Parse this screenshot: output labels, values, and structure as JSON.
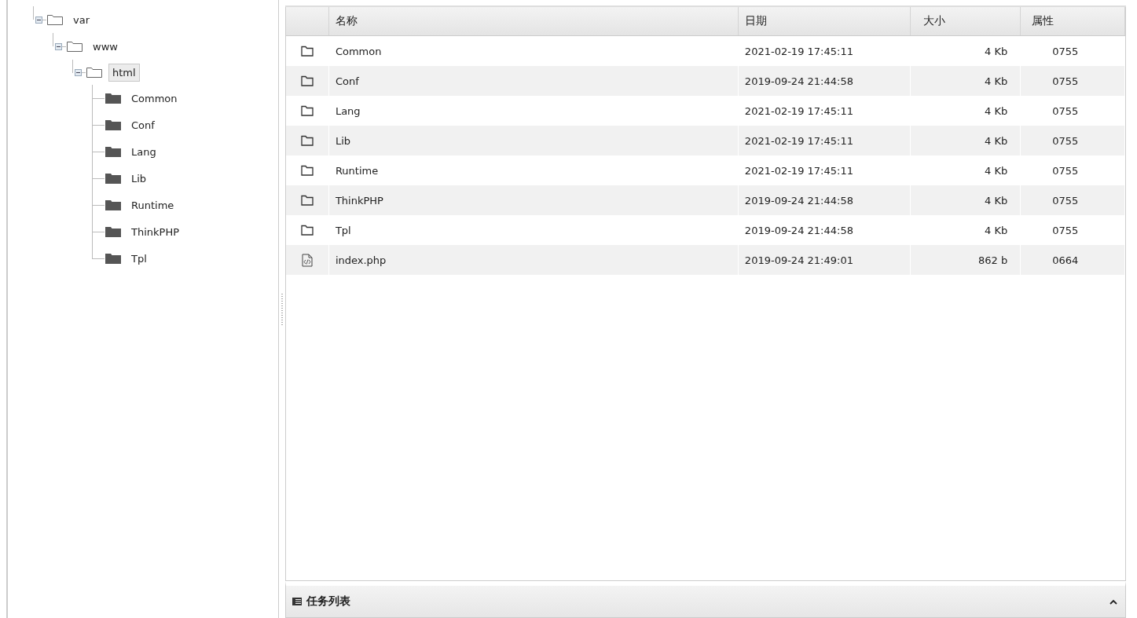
{
  "tree": [
    {
      "label": "var",
      "expanded": true,
      "selected": false,
      "children": [
        {
          "label": "www",
          "expanded": true,
          "selected": false,
          "children": [
            {
              "label": "html",
              "expanded": true,
              "selected": true,
              "children": [
                {
                  "label": "Common",
                  "selected": false
                },
                {
                  "label": "Conf",
                  "selected": false
                },
                {
                  "label": "Lang",
                  "selected": false
                },
                {
                  "label": "Lib",
                  "selected": false
                },
                {
                  "label": "Runtime",
                  "selected": false
                },
                {
                  "label": "ThinkPHP",
                  "selected": false
                },
                {
                  "label": "Tpl",
                  "selected": false
                }
              ]
            }
          ]
        }
      ]
    }
  ],
  "table": {
    "columns": [
      "名称",
      "日期",
      "大小",
      "属性"
    ],
    "rows": [
      {
        "kind": "folder",
        "name": "Common",
        "date": "2021-02-19 17:45:11",
        "size": "4 Kb",
        "mode": "0755"
      },
      {
        "kind": "folder",
        "name": "Conf",
        "date": "2019-09-24 21:44:58",
        "size": "4 Kb",
        "mode": "0755"
      },
      {
        "kind": "folder",
        "name": "Lang",
        "date": "2021-02-19 17:45:11",
        "size": "4 Kb",
        "mode": "0755"
      },
      {
        "kind": "folder",
        "name": "Lib",
        "date": "2021-02-19 17:45:11",
        "size": "4 Kb",
        "mode": "0755"
      },
      {
        "kind": "folder",
        "name": "Runtime",
        "date": "2021-02-19 17:45:11",
        "size": "4 Kb",
        "mode": "0755"
      },
      {
        "kind": "folder",
        "name": "ThinkPHP",
        "date": "2019-09-24 21:44:58",
        "size": "4 Kb",
        "mode": "0755"
      },
      {
        "kind": "folder",
        "name": "Tpl",
        "date": "2019-09-24 21:44:58",
        "size": "4 Kb",
        "mode": "0755"
      },
      {
        "kind": "code",
        "name": "index.php",
        "date": "2019-09-24 21:49:01",
        "size": "862 b",
        "mode": "0664"
      }
    ]
  },
  "task_panel": {
    "title": "任务列表",
    "expanded": false
  }
}
